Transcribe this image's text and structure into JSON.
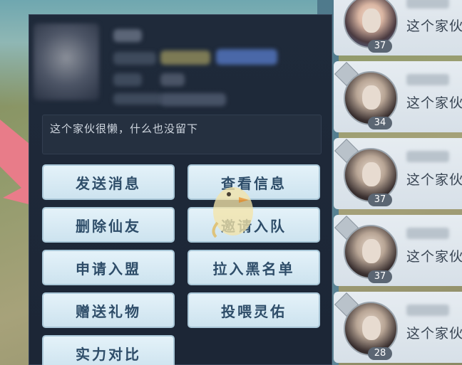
{
  "profile": {
    "signature": "这个家伙很懒，什么也没留下"
  },
  "actions": [
    {
      "label": "发送消息"
    },
    {
      "label": "查看信息"
    },
    {
      "label": "删除仙友"
    },
    {
      "label": "邀请入队"
    },
    {
      "label": "申请入盟"
    },
    {
      "label": "拉入黑名单"
    },
    {
      "label": "赠送礼物"
    },
    {
      "label": "投喂灵佑"
    },
    {
      "label": "实力对比"
    }
  ],
  "friends": [
    {
      "level": "37",
      "message": "这个家伙"
    },
    {
      "level": "34",
      "message": "这个家伙"
    },
    {
      "level": "37",
      "message": "这个家伙"
    },
    {
      "level": "37",
      "message": "这个家伙"
    },
    {
      "level": "28",
      "message": "这个家伙"
    }
  ],
  "colors": {
    "accent_arrow": "#f07a8c",
    "button_text": "#2e4d69",
    "panel_bg": "#1f2a3a"
  }
}
